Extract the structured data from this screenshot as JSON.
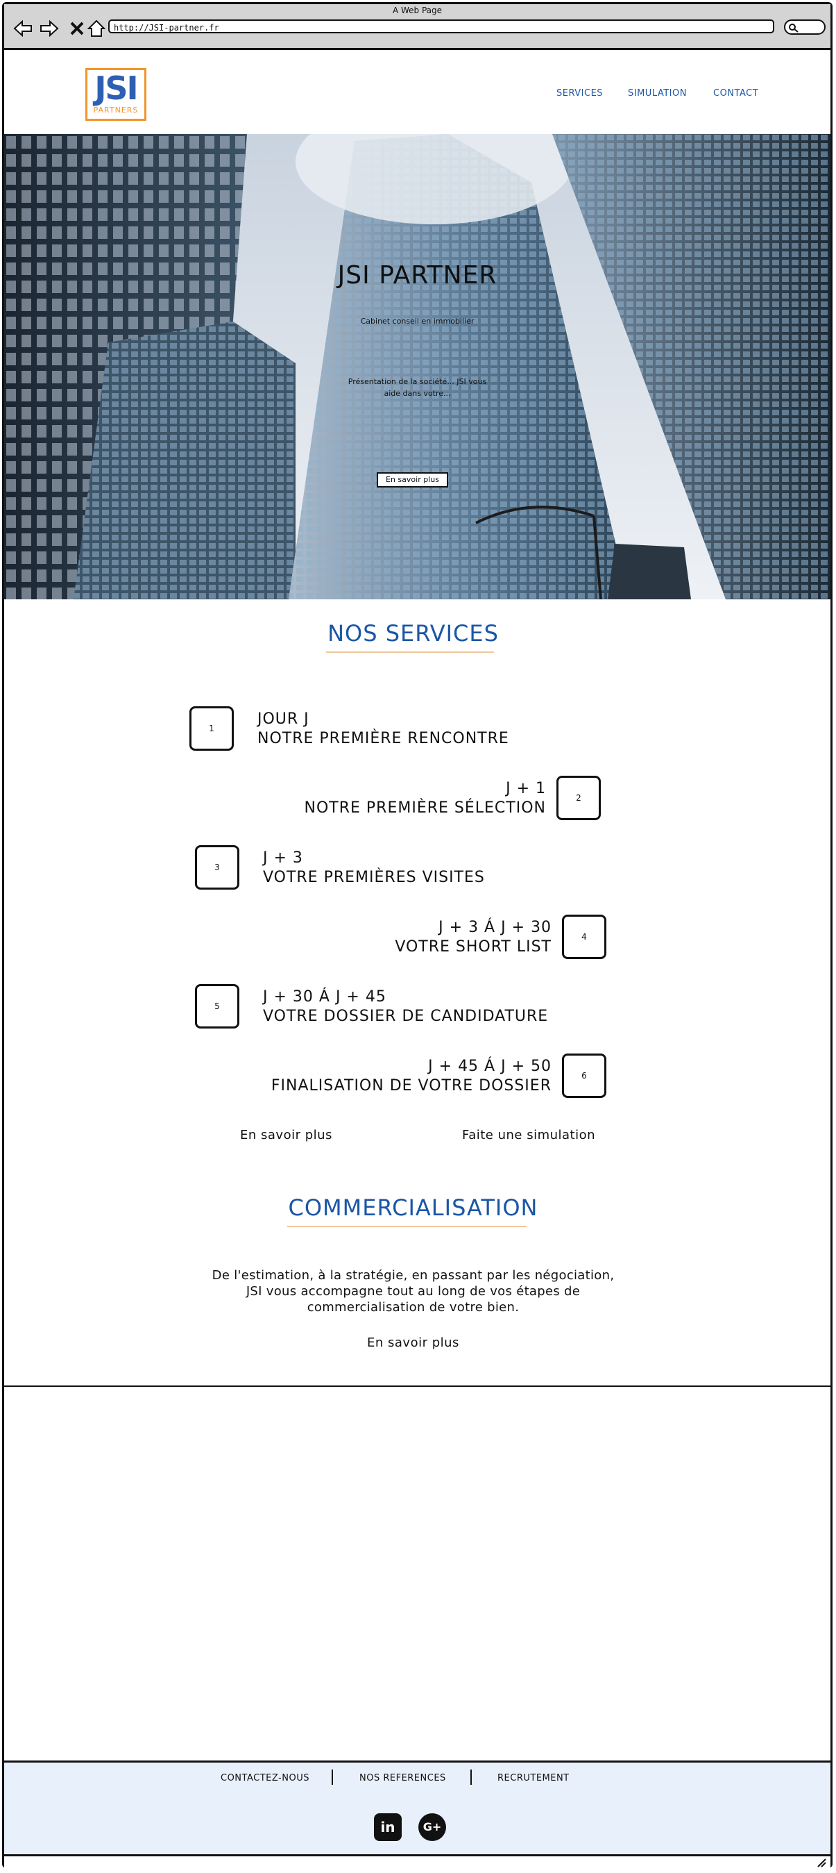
{
  "browser": {
    "window_title": "A Web Page",
    "url": "http://JSI-partner.fr"
  },
  "header": {
    "logo_text": "JSI",
    "logo_sub": "PARTNERS",
    "nav": [
      "SERVICES",
      "SIMULATION",
      "CONTACT"
    ]
  },
  "hero": {
    "title": "JSI PARTNER",
    "subtitle_1": "Cabinet conseil en immobilier",
    "subtitle_2": "Présentation de la société... JSI vous",
    "subtitle_3": "aide dans votre...",
    "button": "En savoir plus"
  },
  "services": {
    "title": "NOS SERVICES",
    "steps": [
      {
        "num": "1",
        "line1": "JOUR J",
        "line2": "NOTRE PREMIÈRE RENCONTRE"
      },
      {
        "num": "2",
        "line1": "J + 1",
        "line2": "NOTRE PREMIÈRE SÉLECTION"
      },
      {
        "num": "3",
        "line1": "J + 3",
        "line2": "VOTRE PREMIÈRES VISITES"
      },
      {
        "num": "4",
        "line1": "J + 3 Á J + 30",
        "line2": "VOTRE SHORT LIST"
      },
      {
        "num": "5",
        "line1": "J + 30 Á J + 45",
        "line2": "VOTRE DOSSIER DE CANDIDATURE"
      },
      {
        "num": "6",
        "line1": "J + 45 Á J + 50",
        "line2": "FINALISATION DE VOTRE DOSSIER"
      }
    ],
    "link_more": "En savoir plus",
    "link_simulation": "Faite une simulation"
  },
  "commercialisation": {
    "title": "COMMERCIALISATION",
    "text_1": "De l'estimation, à la stratégie, en passant par les négociation,",
    "text_2": "JSI vous accompagne tout au long de vos étapes de",
    "text_3": "commercialisation de votre bien.",
    "link_more": "En savoir plus"
  },
  "footer": {
    "links": [
      "CONTACTEZ-NOUS",
      "NOS REFERENCES",
      "RECRUTEMENT"
    ],
    "social": [
      "linkedin-icon",
      "google-plus-icon"
    ]
  },
  "colors": {
    "accent_blue": "#1a56a6",
    "logo_orange": "#f2952b",
    "footer_bg": "#e8f0fc"
  }
}
